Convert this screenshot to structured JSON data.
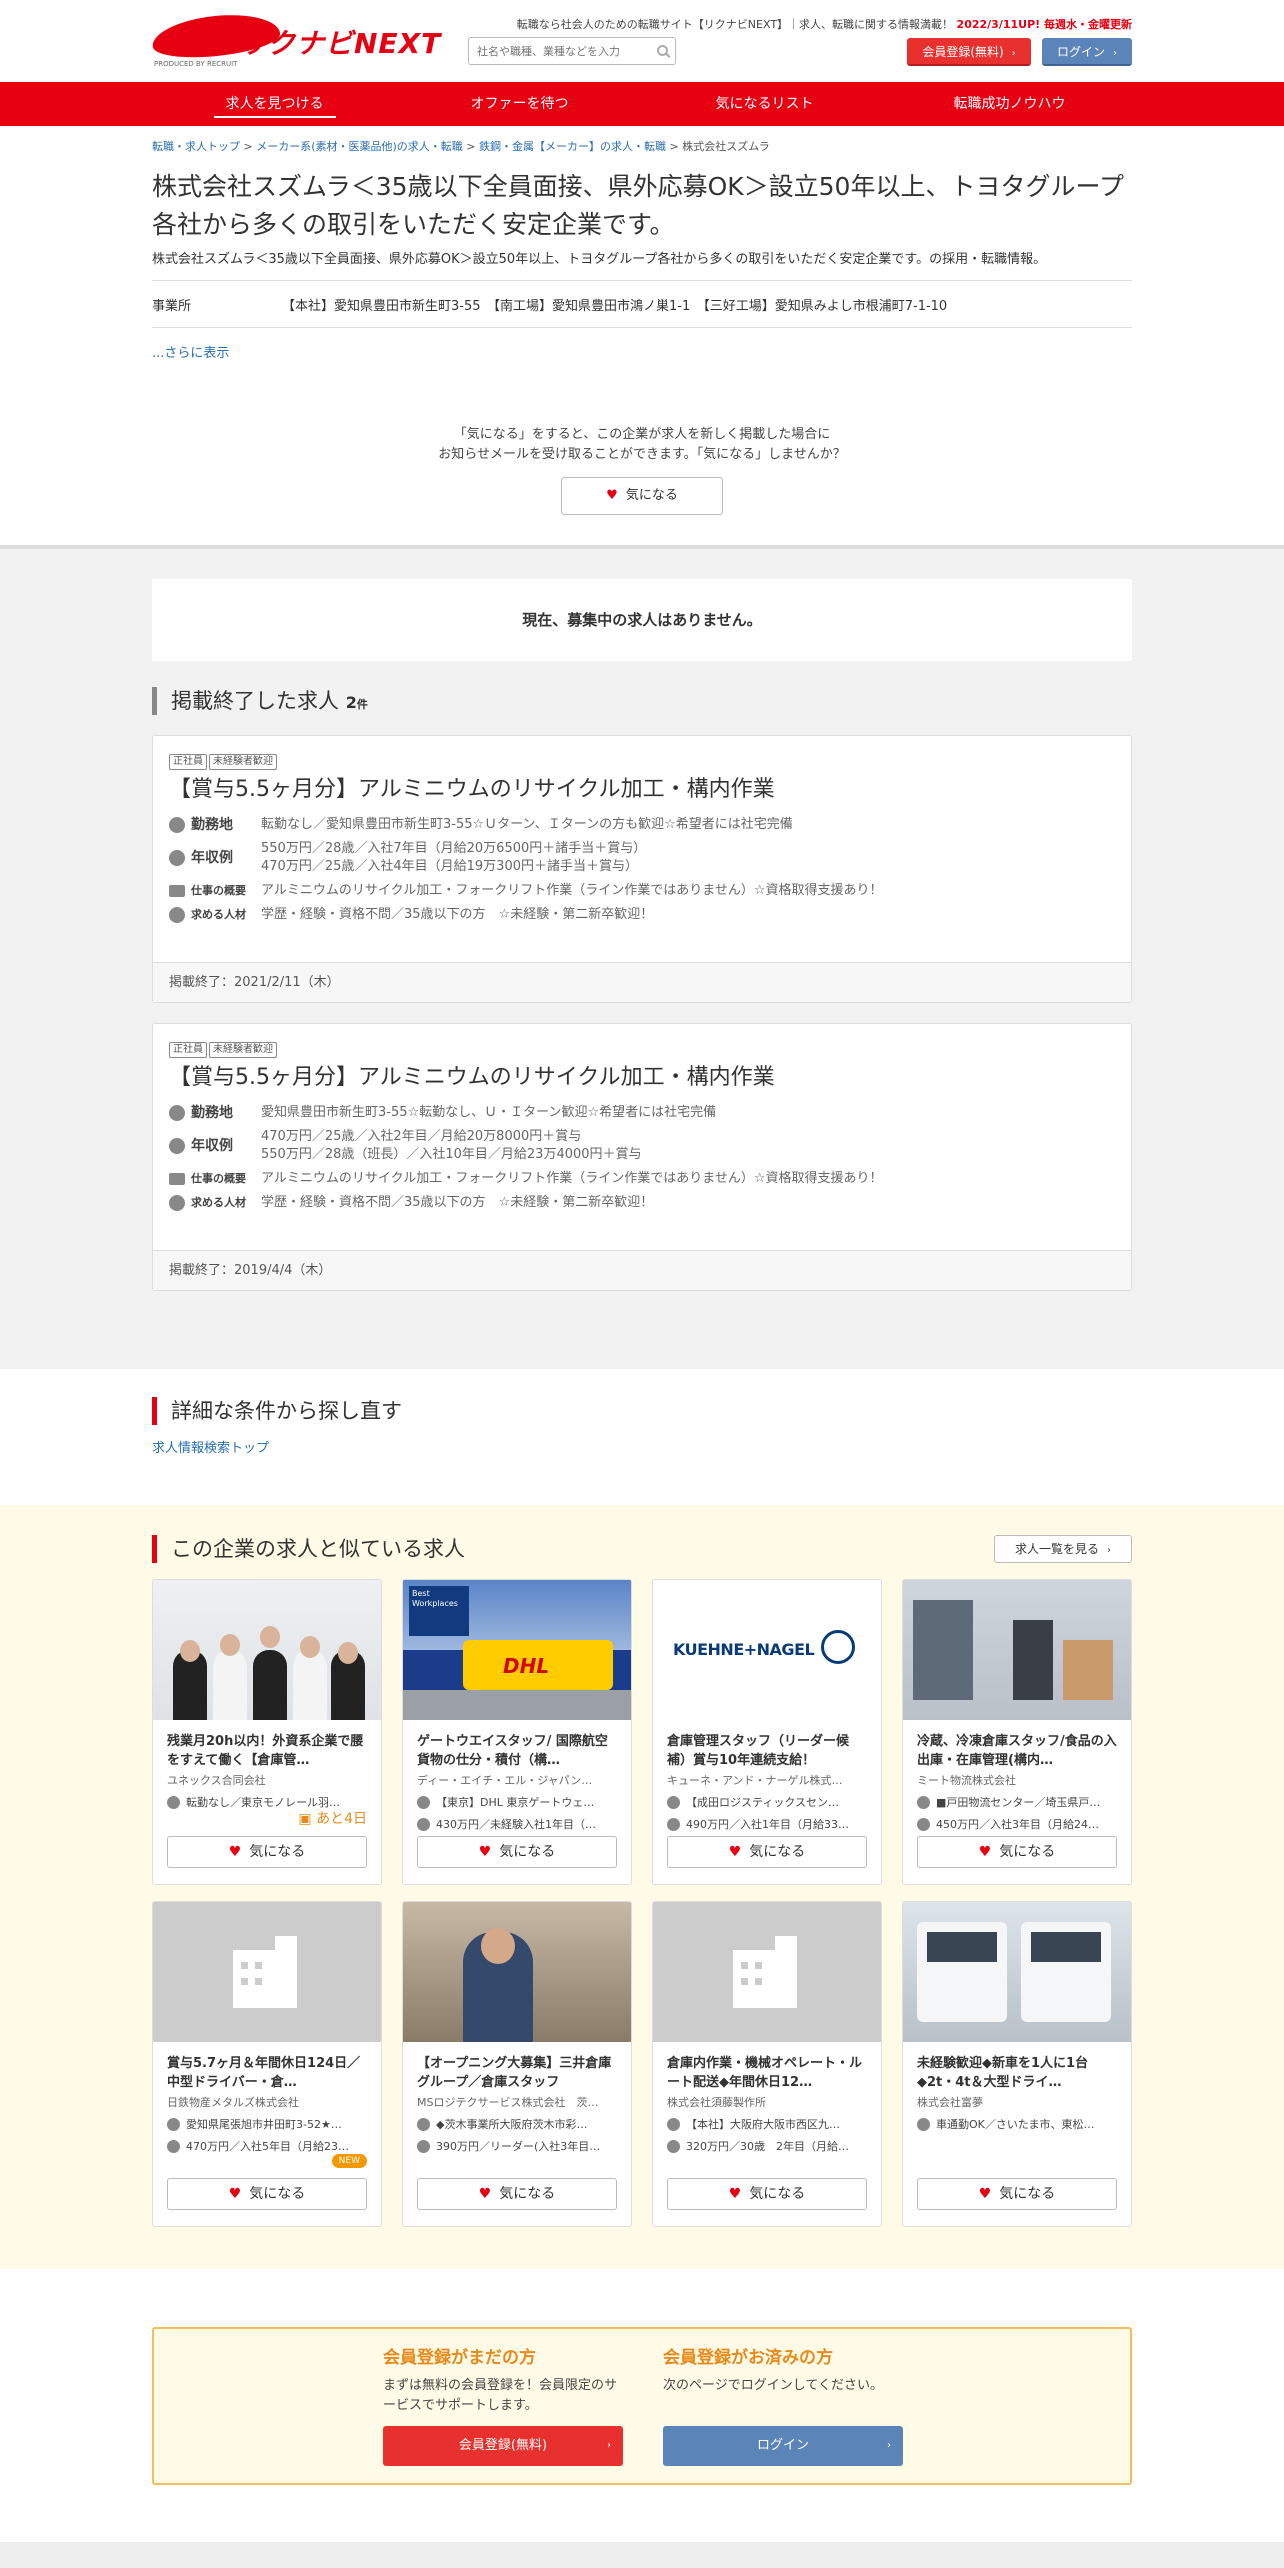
{
  "header": {
    "logo_text": "リクナビNEXT",
    "logo_sub": "PRODUCED BY RECRUIT",
    "tagline_prefix": "転職なら社会人のための転職サイト【リクナビNEXT】｜求人、転職に関する情報満載！",
    "tagline_update": "2022/3/11UP! 毎週水・金曜更新",
    "search_placeholder": "社名や職種、業種などを入力",
    "register_label": "会員登録(無料)",
    "login_label": "ログイン"
  },
  "nav": [
    "求人を見つける",
    "オファーを待つ",
    "気になるリスト",
    "転職成功ノウハウ"
  ],
  "breadcrumb": [
    "転職・求人トップ",
    "メーカー系(素材・医薬品他)の求人・転職",
    "鉄鋼・金属【メーカー】の求人・転職",
    "株式会社スズムラ"
  ],
  "company": {
    "title": "株式会社スズムラ＜35歳以下全員面接、県外応募OK＞設立50年以上、トヨタグループ各社から多くの取引をいただく安定企業です。",
    "subtitle": "株式会社スズムラ＜35歳以下全員面接、県外応募OK＞設立50年以上、トヨタグループ各社から多くの取引をいただく安定企業です。の採用・転職情報。",
    "office_label": "事業所",
    "office_value": "【本社】愛知県豊田市新生町3-55　【南工場】愛知県豊田市鴻ノ巣1-1　【三好工場】愛知県みよし市根浦町7-1-10",
    "more_link": "...さらに表示"
  },
  "kininaru": {
    "line1": "「気になる」をすると、この企業が求人を新しく掲載した場合に",
    "line2": "お知らせメールを受け取ることができます。「気になる」しませんか？",
    "button": "気になる"
  },
  "no_jobs": "現在、募集中の求人はありません。",
  "ended": {
    "heading": "掲載終了した求人",
    "count": "2",
    "unit": "件",
    "jobs": [
      {
        "tags": [
          "正社員",
          "未経験者歓迎"
        ],
        "title": "【賞与5.5ヶ月分】アルミニウムのリサイクル加工・構内作業",
        "location_label": "勤務地",
        "location": "転勤なし／愛知県豊田市新生町3-55☆Ｕターン、Ｉターンの方も歓迎☆希望者には社宅完備",
        "salary_label": "年収例",
        "salary1": "550万円／28歳／入社7年目（月給20万6500円＋諸手当＋賞与）",
        "salary2": "470万円／25歳／入社4年目（月給19万300円＋諸手当＋賞与）",
        "summary_label": "仕事の概要",
        "summary": "アルミニウムのリサイクル加工・フォークリフト作業（ライン作業ではありません）☆資格取得支援あり！",
        "req_label": "求める人材",
        "req": "学歴・経験・資格不問／35歳以下の方　☆未経験・第二新卒歓迎！",
        "end": "掲載終了：2021/2/11（木）"
      },
      {
        "tags": [
          "正社員",
          "未経験者歓迎"
        ],
        "title": "【賞与5.5ヶ月分】アルミニウムのリサイクル加工・構内作業",
        "location_label": "勤務地",
        "location": "愛知県豊田市新生町3-55☆転勤なし、Ｕ・Ｉターン歓迎☆希望者には社宅完備",
        "salary_label": "年収例",
        "salary1": "470万円／25歳／入社2年目／月給20万8000円＋賞与",
        "salary2": "550万円／28歳（班長）／入社10年目／月給23万4000円＋賞与",
        "summary_label": "仕事の概要",
        "summary": "アルミニウムのリサイクル加工・フォークリフト作業（ライン作業ではありません）☆資格取得支援あり！",
        "req_label": "求める人材",
        "req": "学歴・経験・資格不問／35歳以下の方　☆未経験・第二新卒歓迎！",
        "end": "掲載終了：2019/4/4（木）"
      }
    ]
  },
  "search_again": {
    "heading": "詳細な条件から探し直す",
    "link": "求人情報検索トップ"
  },
  "similar": {
    "heading": "この企業の求人と似ている求人",
    "list_button": "求人一覧を見る",
    "fav_label": "気になる",
    "cards": [
      {
        "title": "残業月20h以内！外資系企業で腰をすえて働く【倉庫管…",
        "company": "ユネックス合同会社",
        "line1": "転勤なし／東京モノレール羽…",
        "badge": "あと4日"
      },
      {
        "title": "ゲートウエイスタッフ/ 国際航空貨物の仕分・積付（構…",
        "company": "ディー・エイチ・エル・ジャパン…",
        "line1": "【東京】DHL 東京ゲートウェ…",
        "line2": "430万円／未経験入社1年目（…"
      },
      {
        "title": "倉庫管理スタッフ（リーダー候補）賞与10年連続支給！",
        "company": "キューネ・アンド・ナーゲル株式…",
        "line1": "【成田ロジスティックスセン…",
        "line2": "490万円／入社1年目（月給33…"
      },
      {
        "title": "冷蔵、冷凍倉庫スタッフ/食品の入出庫・在庫管理(構内…",
        "company": "ミート物流株式会社",
        "line1": "■戸田物流センター／埼玉県戸…",
        "line2": "450万円／入社3年目（月給24…"
      },
      {
        "title": "賞与5.7ヶ月＆年間休日124日／中型ドライバー・倉…",
        "company": "日鉄物産メタルズ株式会社",
        "line1": "愛知県尾張旭市井田町3-52★…",
        "line2": "470万円／入社5年目（月給23…",
        "badge": "NEW"
      },
      {
        "title": "【オープニング大募集】三井倉庫グループ／倉庫スタッフ",
        "company": "MSロジテクサービス株式会社　茨…",
        "line1": "◆茨木事業所大阪府茨木市彩…",
        "line2": "390万円／リーダー(入社3年目…"
      },
      {
        "title": "倉庫内作業・機械オペレート・ルート配送◆年間休日12…",
        "company": "株式会社須藤製作所",
        "line1": "【本社】大阪府大阪市西区九…",
        "line2": "320万円／30歳　2年目（月給…"
      },
      {
        "title": "未経験歓迎◆新車を1人に1台◆2t・4t＆大型ドライ…",
        "company": "株式会社富夢",
        "line1": "車通勤OK／さいたま市、東松…"
      }
    ]
  },
  "member": {
    "new_heading": "会員登録がまだの方",
    "new_text": "まずは無料の会員登録を！会員限定のサービスでサポートします。",
    "new_button": "会員登録(無料)",
    "exist_heading": "会員登録がお済みの方",
    "exist_text": "次のページでログインしてください。",
    "exist_button": "ログイン"
  },
  "thumb_text": {
    "best": "Best Workplaces",
    "dhl": "DHL",
    "kn": "KUEHNE+NAGEL"
  }
}
